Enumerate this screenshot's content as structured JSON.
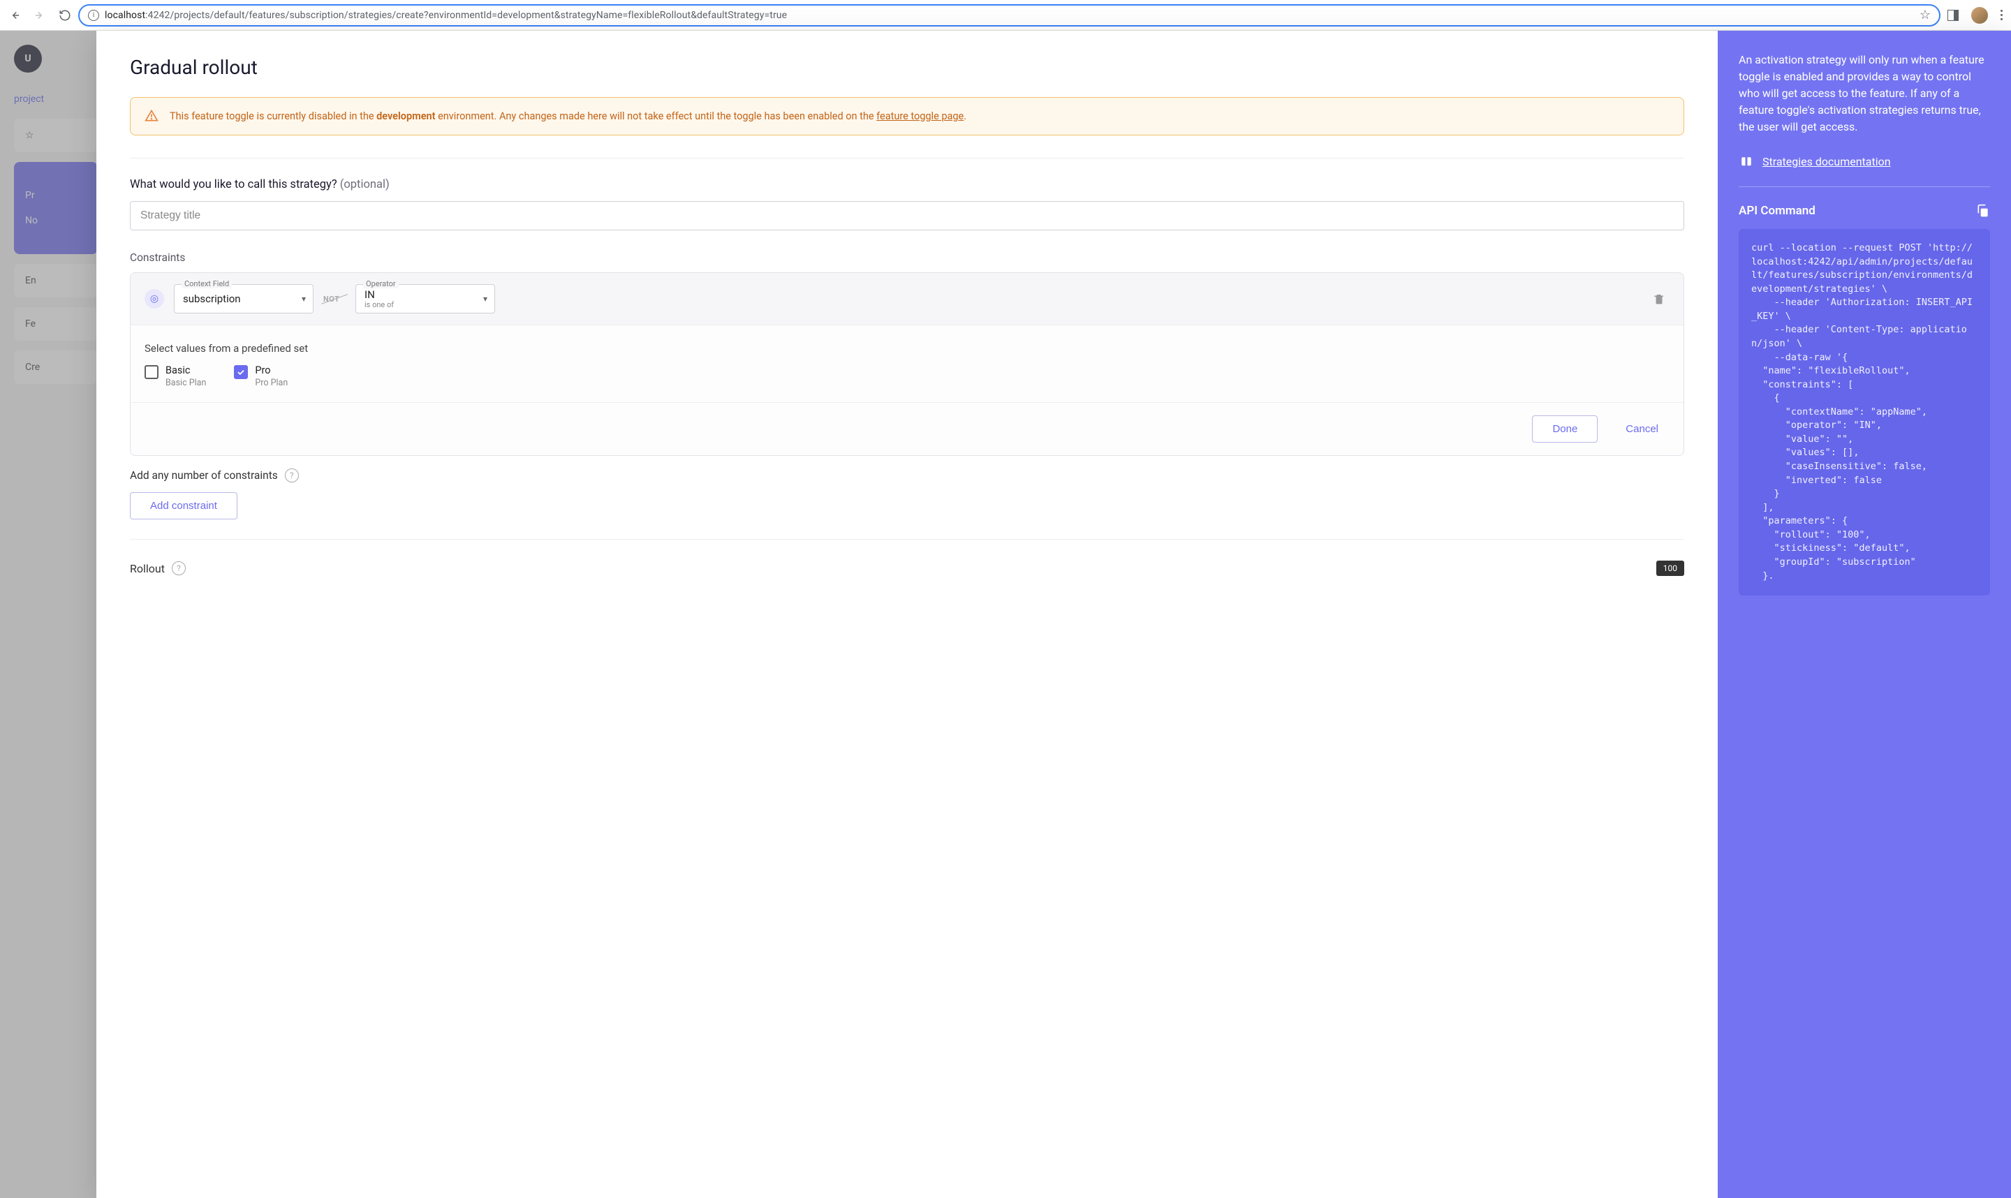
{
  "browser": {
    "url_prefix": "localhost",
    "url_path": ":4242/projects/default/features/subscription/strategies/create?environmentId=development&strategyName=flexibleRollout&defaultStrategy=true"
  },
  "backdrop": {
    "breadcrumb": "project",
    "sidebar_items": [
      "Pr",
      "No"
    ],
    "cards": [
      "En",
      "Fe",
      "Cre"
    ]
  },
  "form": {
    "title": "Gradual rollout",
    "warning_prefix": "This feature toggle is currently disabled in the ",
    "warning_env": "development",
    "warning_mid": " environment. Any changes made here will not take effect until the toggle has been enabled on the ",
    "warning_link": "feature toggle page",
    "strategy_label": "What would you like to call this strategy?",
    "strategy_optional": "(optional)",
    "strategy_placeholder": "Strategy title",
    "constraints_label": "Constraints",
    "context_legend": "Context Field",
    "context_value": "subscription",
    "operator_legend": "Operator",
    "operator_value": "IN",
    "operator_sub": "is one of",
    "not_label": "NOT",
    "values_label": "Select values from a predefined set",
    "options": [
      {
        "title": "Basic",
        "sub": "Basic Plan",
        "checked": false
      },
      {
        "title": "Pro",
        "sub": "Pro Plan",
        "checked": true
      }
    ],
    "done": "Done",
    "cancel": "Cancel",
    "add_constraints_helper": "Add any number of constraints",
    "add_constraint_btn": "Add constraint",
    "rollout_label": "Rollout",
    "rollout_value": "100"
  },
  "sidebar": {
    "description": "An activation strategy will only run when a feature toggle is enabled and provides a way to control who will get access to the feature. If any of a feature toggle's activation strategies returns true, the user will get access.",
    "doc_link": "Strategies documentation",
    "api_heading": "API Command",
    "code": "curl --location --request POST 'http://localhost:4242/api/admin/projects/default/features/subscription/environments/development/strategies' \\\n    --header 'Authorization: INSERT_API_KEY' \\\n    --header 'Content-Type: application/json' \\\n    --data-raw '{\n  \"name\": \"flexibleRollout\",\n  \"constraints\": [\n    {\n      \"contextName\": \"appName\",\n      \"operator\": \"IN\",\n      \"value\": \"\",\n      \"values\": [],\n      \"caseInsensitive\": false,\n      \"inverted\": false\n    }\n  ],\n  \"parameters\": {\n    \"rollout\": \"100\",\n    \"stickiness\": \"default\",\n    \"groupId\": \"subscription\"\n  }."
  }
}
